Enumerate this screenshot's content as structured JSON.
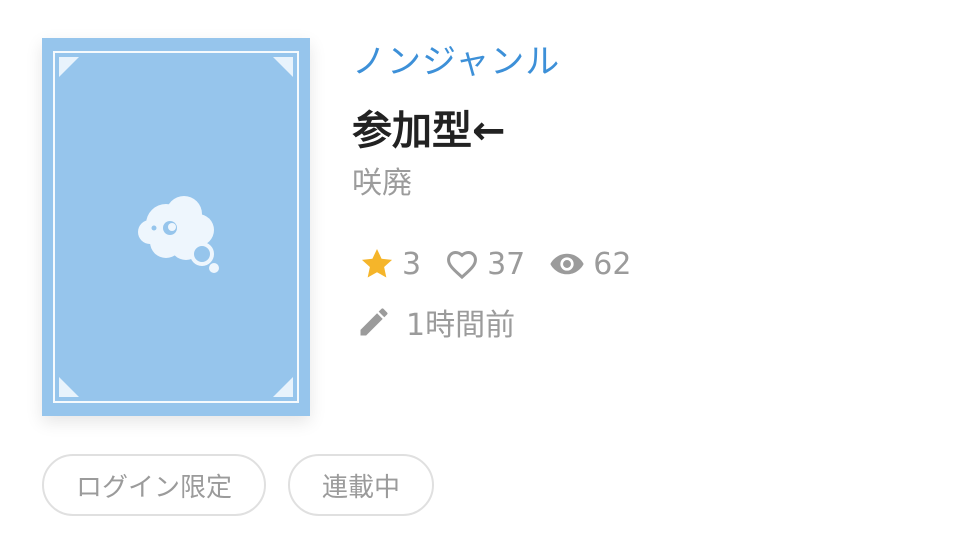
{
  "work": {
    "genre": "ノンジャンル",
    "title": "参加型←",
    "author": "咲廃",
    "stars": "3",
    "likes": "37",
    "views": "62",
    "updated": "1時間前"
  },
  "tags": [
    "ログイン限定",
    "連載中"
  ],
  "colors": {
    "genre": "#3d90d8",
    "cover": "#96c5ec",
    "star": "#f5b52a",
    "muted": "#9b9b9b"
  },
  "icons": {
    "cover": "thought-bubble-icon",
    "star": "star-icon",
    "like": "heart-outline-icon",
    "views": "eye-icon",
    "updated": "pencil-icon"
  }
}
